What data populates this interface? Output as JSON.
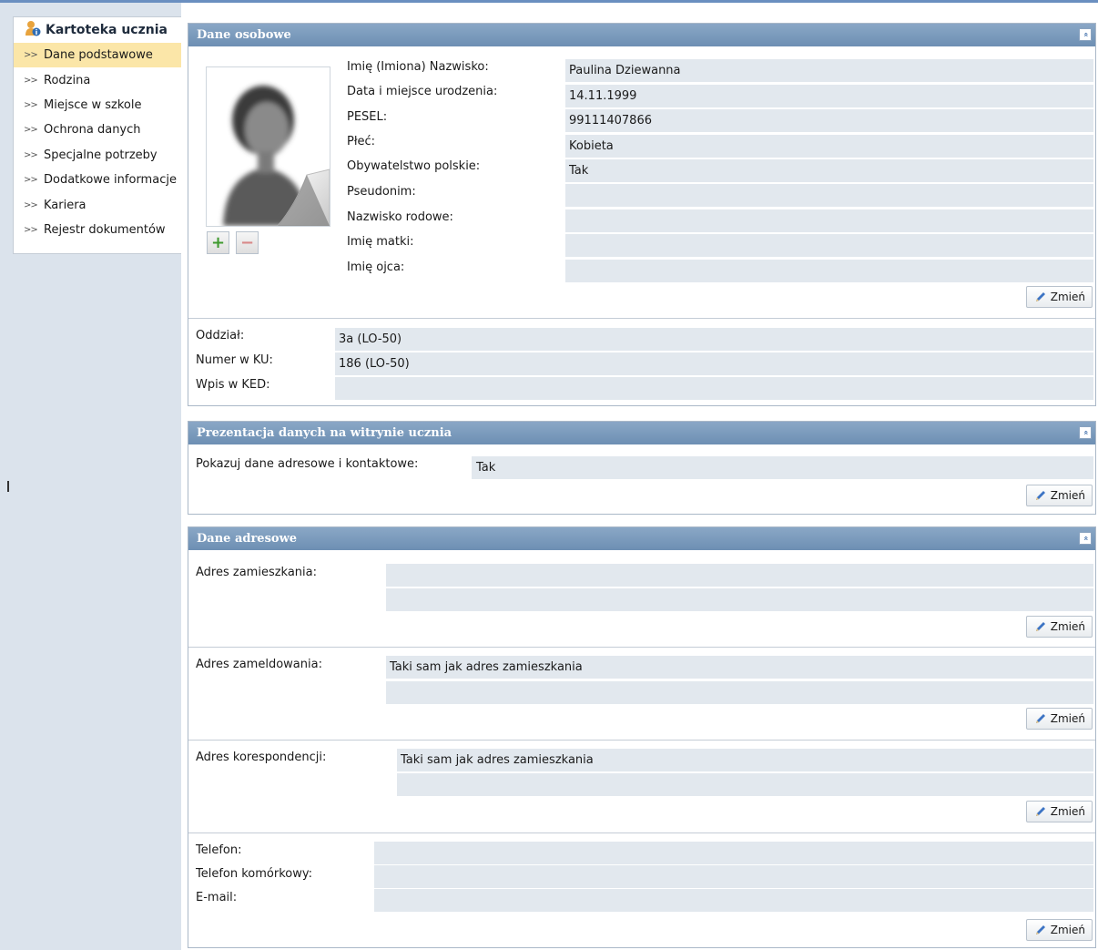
{
  "sidebar": {
    "title": "Kartoteka ucznia",
    "items": [
      {
        "label": "Dane podstawowe",
        "active": true
      },
      {
        "label": "Rodzina"
      },
      {
        "label": "Miejsce w szkole"
      },
      {
        "label": "Ochrona danych"
      },
      {
        "label": "Specjalne potrzeby"
      },
      {
        "label": "Dodatkowe informacje"
      },
      {
        "label": "Kariera"
      },
      {
        "label": "Rejestr dokumentów"
      }
    ]
  },
  "personal": {
    "header": "Dane osobowe",
    "fields": [
      {
        "label": "Imię (Imiona) Nazwisko:",
        "value": "Paulina Dziewanna"
      },
      {
        "label": "Data i miejsce urodzenia:",
        "value": "14.11.1999"
      },
      {
        "label": "PESEL:",
        "value": "99111407866"
      },
      {
        "label": "Płeć:",
        "value": "Kobieta"
      },
      {
        "label": "Obywatelstwo polskie:",
        "value": "Tak"
      },
      {
        "label": "Pseudonim:",
        "value": ""
      },
      {
        "label": "Nazwisko rodowe:",
        "value": ""
      },
      {
        "label": "Imię matki:",
        "value": ""
      },
      {
        "label": "Imię ojca:",
        "value": ""
      }
    ],
    "class_fields": [
      {
        "label": "Oddział:",
        "value": "3a (LO-50)"
      },
      {
        "label": "Numer w KU:",
        "value": "186 (LO-50)"
      },
      {
        "label": "Wpis w KED:",
        "value": ""
      }
    ],
    "add_icon": "+",
    "remove_icon": "−"
  },
  "presentation": {
    "header": "Prezentacja danych na witrynie ucznia",
    "label": "Pokazuj dane adresowe i kontaktowe:",
    "value": "Tak"
  },
  "address": {
    "header": "Dane adresowe",
    "residence": {
      "label": "Adres zamieszkania:",
      "line1": "",
      "line2": ""
    },
    "registered": {
      "label": "Adres zameldowania:",
      "line1": "Taki sam jak adres zamieszkania",
      "line2": ""
    },
    "correspondence": {
      "label": "Adres korespondencji:",
      "line1": "Taki sam jak adres zamieszkania",
      "line2": ""
    },
    "contact": [
      {
        "label": "Telefon:",
        "value": ""
      },
      {
        "label": "Telefon komórkowy:",
        "value": ""
      },
      {
        "label": "E-mail:",
        "value": ""
      }
    ]
  },
  "buttons": {
    "change": "Zmień",
    "collapse_icon": "«"
  },
  "colors": {
    "header": "#7a9abd",
    "field_bg": "#e2e8ee",
    "active_item": "#fbe6a8",
    "sidebar_bg": "#dbe3ec"
  }
}
